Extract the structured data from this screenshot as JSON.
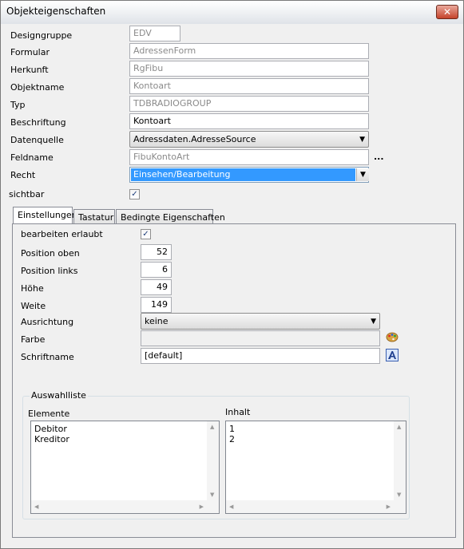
{
  "window": {
    "title": "Objekteigenschaften",
    "close_glyph": "✕"
  },
  "properties": {
    "designgruppe": {
      "label": "Designgruppe",
      "value": "EDV"
    },
    "formular": {
      "label": "Formular",
      "value": "AdressenForm"
    },
    "herkunft": {
      "label": "Herkunft",
      "value": "RgFibu"
    },
    "objektname": {
      "label": "Objektname",
      "value": "Kontoart"
    },
    "typ": {
      "label": "Typ",
      "value": "TDBRADIOGROUP"
    },
    "beschriftung": {
      "label": "Beschriftung",
      "value": "Kontoart"
    },
    "datenquelle": {
      "label": "Datenquelle",
      "value": "Adressdaten.AdresseSource"
    },
    "feldname": {
      "label": "Feldname",
      "value": "FibuKontoArt",
      "browse": "..."
    },
    "recht": {
      "label": "Recht",
      "value": "Einsehen/Bearbeitung"
    },
    "sichtbar": {
      "label": "sichtbar",
      "checked": true,
      "mark": "✓"
    }
  },
  "tabs": [
    {
      "label": "Einstellungen",
      "active": true
    },
    {
      "label": "Tastatur",
      "active": false
    },
    {
      "label": "Bedingte Eigenschaften",
      "active": false
    }
  ],
  "einstellungen": {
    "bearbeiten": {
      "label": "bearbeiten erlaubt",
      "checked": true,
      "mark": "✓"
    },
    "position_oben": {
      "label": "Position oben",
      "value": "52"
    },
    "position_links": {
      "label": "Position links",
      "value": "6"
    },
    "hoehe": {
      "label": "Höhe",
      "value": "49"
    },
    "weite": {
      "label": "Weite",
      "value": "149"
    },
    "ausrichtung": {
      "label": "Ausrichtung",
      "value": "keine"
    },
    "farbe": {
      "label": "Farbe",
      "value": "",
      "icon": "palette-icon"
    },
    "schriftname": {
      "label": "Schriftname",
      "value": "[default]",
      "icon": "font-icon"
    }
  },
  "auswahlliste": {
    "legend": "Auswahlliste",
    "elemente": {
      "label": "Elemente",
      "items": [
        "Debitor",
        "Kreditor"
      ]
    },
    "inhalt": {
      "label": "Inhalt",
      "items": [
        "1",
        "2"
      ]
    }
  },
  "colors": {
    "selection": "#3399ff",
    "border": "#abadb3"
  }
}
